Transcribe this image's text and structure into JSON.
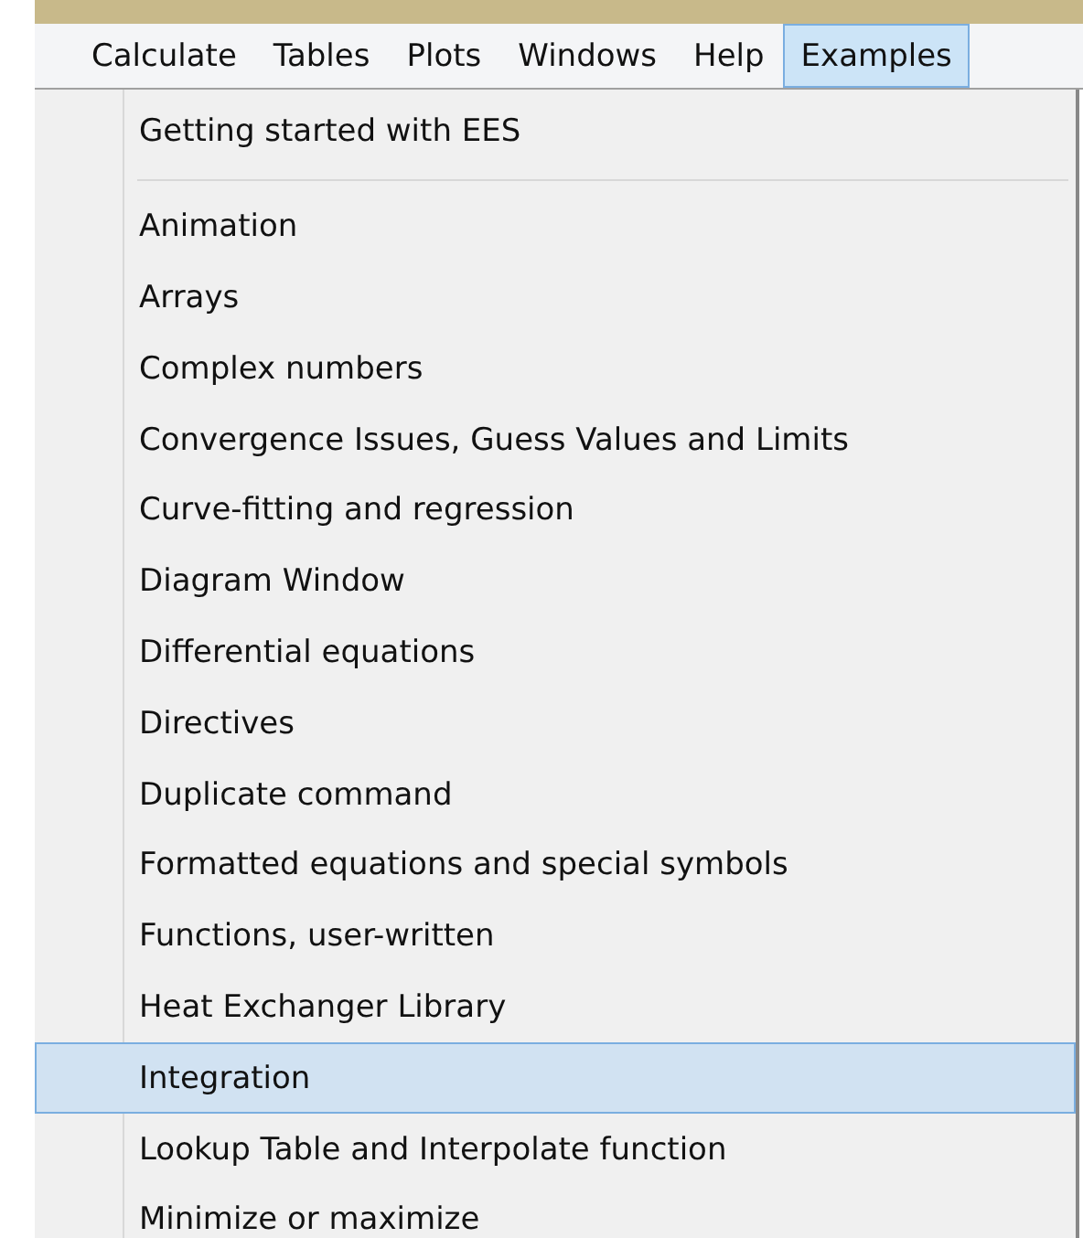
{
  "menubar": [
    {
      "label": "Calculate",
      "selected": false
    },
    {
      "label": "Tables",
      "selected": false
    },
    {
      "label": "Plots",
      "selected": false
    },
    {
      "label": "Windows",
      "selected": false
    },
    {
      "label": "Help",
      "selected": false
    },
    {
      "label": "Examples",
      "selected": true
    }
  ],
  "menu": {
    "items": [
      {
        "kind": "item",
        "label": "Getting started with EES",
        "selected": false
      },
      {
        "kind": "separator"
      },
      {
        "kind": "item",
        "label": "Animation",
        "selected": false
      },
      {
        "kind": "item",
        "label": "Arrays",
        "selected": false
      },
      {
        "kind": "item",
        "label": "Complex numbers",
        "selected": false
      },
      {
        "kind": "item",
        "label": "Convergence Issues, Guess Values and Limits",
        "selected": false
      },
      {
        "kind": "item",
        "label": "Curve-fitting and regression",
        "selected": false
      },
      {
        "kind": "item",
        "label": "Diagram Window",
        "selected": false
      },
      {
        "kind": "item",
        "label": "Differential equations",
        "selected": false
      },
      {
        "kind": "item",
        "label": "Directives",
        "selected": false
      },
      {
        "kind": "item",
        "label": "Duplicate command",
        "selected": false
      },
      {
        "kind": "item",
        "label": "Formatted equations and special symbols",
        "selected": false
      },
      {
        "kind": "item",
        "label": "Functions, user-written",
        "selected": false
      },
      {
        "kind": "item",
        "label": "Heat Exchanger Library",
        "selected": false
      },
      {
        "kind": "item",
        "label": "Integration",
        "selected": true
      },
      {
        "kind": "item",
        "label": "Lookup Table and Interpolate function",
        "selected": false
      },
      {
        "kind": "item",
        "label": "Minimize or maximize",
        "selected": false
      }
    ]
  }
}
